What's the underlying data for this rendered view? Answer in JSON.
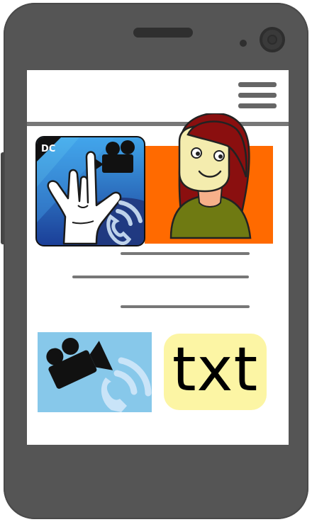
{
  "tiles": {
    "sign_language_app_icon": "sign-language-video-call-icon",
    "avatar": "woman-avatar-icon",
    "video_call": "video-call-icon",
    "text": {
      "label": "txt"
    }
  },
  "colors": {
    "phone_body": "#555555",
    "screen": "#ffffff",
    "avatar_background": "#ff6a00",
    "video_tile_background": "#87c8ea",
    "txt_tile_background": "#fcf5a4"
  }
}
